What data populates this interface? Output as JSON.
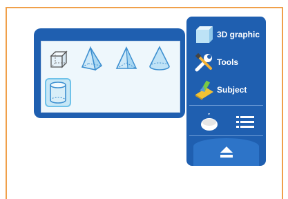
{
  "toolbar": {
    "items": [
      {
        "label": "3D graphic",
        "icon": "cube-graphic-icon"
      },
      {
        "label": "Tools",
        "icon": "tools-icon"
      },
      {
        "label": "Subject",
        "icon": "subject-icon"
      }
    ],
    "bottom_icons": [
      "mouse-icon",
      "list-icon"
    ],
    "collapse_icon": "eject-icon"
  },
  "shapes": {
    "items": [
      "cube-icon",
      "pyramid-square-icon",
      "pyramid-triangle-icon",
      "cone-icon",
      "cylinder-icon"
    ],
    "selected": "cylinder-icon"
  },
  "colors": {
    "panel": "#1f5fb0",
    "accent": "#6fc2e9",
    "frame": "#f0a04a"
  }
}
